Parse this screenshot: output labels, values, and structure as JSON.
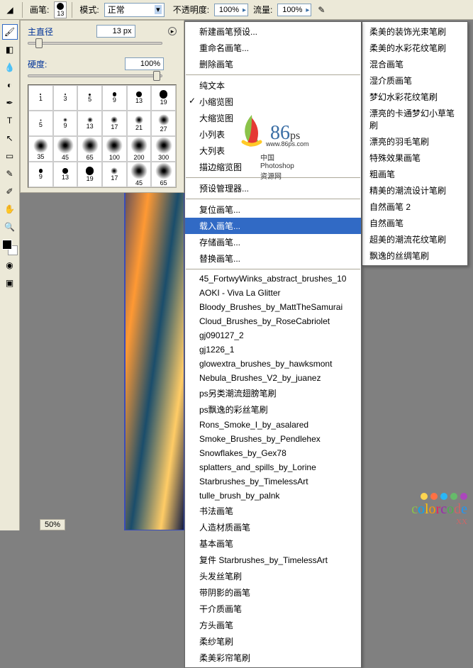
{
  "toolbar": {
    "brush_label": "画笔:",
    "brush_size_preview": "13",
    "mode_label": "模式:",
    "mode_value": "正常",
    "opacity_label": "不透明度:",
    "opacity_value": "100%",
    "flow_label": "流量:",
    "flow_value": "100%"
  },
  "brush_panel": {
    "diameter_label": "主直径",
    "diameter_value": "13 px",
    "hardness_label": "硬度:",
    "hardness_value": "100%",
    "presets": [
      {
        "s": 1,
        "t": "hard"
      },
      {
        "s": 3,
        "t": "hard"
      },
      {
        "s": 5,
        "t": "hard"
      },
      {
        "s": 9,
        "t": "hard"
      },
      {
        "s": 13,
        "t": "hard"
      },
      {
        "s": 19,
        "t": "hard"
      },
      {
        "s": 5,
        "t": "soft"
      },
      {
        "s": 9,
        "t": "soft"
      },
      {
        "s": 13,
        "t": "soft"
      },
      {
        "s": 17,
        "t": "soft"
      },
      {
        "s": 21,
        "t": "soft"
      },
      {
        "s": 27,
        "t": "soft"
      },
      {
        "s": 35,
        "t": "soft"
      },
      {
        "s": 45,
        "t": "soft"
      },
      {
        "s": 65,
        "t": "soft"
      },
      {
        "s": 100,
        "t": "soft"
      },
      {
        "s": 200,
        "t": "soft"
      },
      {
        "s": 300,
        "t": "soft"
      },
      {
        "s": 9,
        "t": "hard"
      },
      {
        "s": 13,
        "t": "hard"
      },
      {
        "s": 19,
        "t": "hard"
      },
      {
        "s": 17,
        "t": "soft"
      },
      {
        "s": 45,
        "t": "soft"
      },
      {
        "s": 65,
        "t": "soft"
      }
    ]
  },
  "context_menu": {
    "section1": [
      "新建画笔预设...",
      "重命名画笔...",
      "删除画笔"
    ],
    "section2": [
      "纯文本",
      "小缩览图",
      "大缩览图",
      "小列表",
      "大列表",
      "描边缩览图"
    ],
    "checked": "小缩览图",
    "section3": [
      "预设管理器..."
    ],
    "section4": [
      "复位画笔...",
      "载入画笔...",
      "存储画笔...",
      "替换画笔..."
    ],
    "highlighted": "载入画笔...",
    "section5": [
      "45_FortwyWinks_abstract_brushes_10",
      "AOKI - Viva La Glitter",
      "Bloody_Brushes_by_MattTheSamurai",
      "Cloud_Brushes_by_RoseCabriolet",
      "gj090127_2",
      "gj1226_1",
      "glowextra_brushes_by_hawksmont",
      "Nebula_Brushes_V2_by_juanez",
      "ps另类潮流翅膀笔刷",
      "ps飘逸的彩丝笔刷",
      "Rons_Smoke_I_by_asalared",
      "Smoke_Brushes_by_Pendlehex",
      "Snowflakes_by_Gex78",
      "splatters_and_spills_by_Lorine",
      "Starbrushes_by_TimelessArt",
      "tulle_brush_by_palnk",
      "书法画笔",
      "人造材质画笔",
      "基本画笔",
      "复件 Starbrushes_by_TimelessArt",
      "头发丝笔刷",
      "带阴影的画笔",
      "干介质画笔",
      "方头画笔",
      "柔纱笔刷",
      "柔美彩帘笔刷"
    ]
  },
  "submenu": [
    "柔美的装饰光束笔刷",
    "柔美的水彩花纹笔刷",
    "混合画笔",
    "湿介质画笔",
    "梦幻水彩花纹笔刷",
    "漂亮的卡通梦幻小草笔刷",
    "漂亮的羽毛笔刷",
    "特殊效果画笔",
    "粗画笔",
    "精美的潮流设计笔刷",
    "自然画笔 2",
    "自然画笔",
    "超美的潮流花纹笔刷",
    "飘逸的丝绸笔刷"
  ],
  "tools": [
    "brush",
    "gradient",
    "blur",
    "dodge",
    "pen",
    "type",
    "path",
    "shape",
    "notes",
    "eyedrop",
    "hand",
    "zoom"
  ],
  "zoom_value": "50%",
  "watermark": {
    "brand": "86",
    "suffix": "ps",
    "url": "www.86ps.com",
    "tagline": "中国Photoshop资源网"
  },
  "colorcode": {
    "letters": [
      {
        "c": "c",
        "col": "#8bc34a"
      },
      {
        "c": "o",
        "col": "#03a9f4"
      },
      {
        "c": "l",
        "col": "#ffc107"
      },
      {
        "c": "o",
        "col": "#ff9800"
      },
      {
        "c": "r",
        "col": "#e91e63"
      },
      {
        "c": "c",
        "col": "#9c27b0"
      },
      {
        "c": "o",
        "col": "#4caf50"
      },
      {
        "c": "d",
        "col": "#cc6666"
      },
      {
        "c": "e",
        "col": "#2196f3"
      }
    ],
    "dots": [
      "#ffd54f",
      "#ff7043",
      "#29b6f6",
      "#66bb6a",
      "#ab47bc"
    ],
    "suffix": "XX"
  }
}
